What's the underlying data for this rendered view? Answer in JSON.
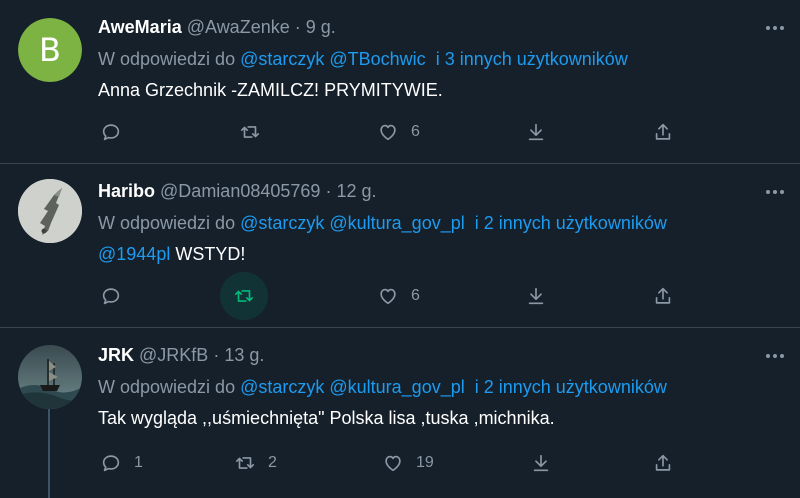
{
  "tweets": [
    {
      "name": "AweMaria",
      "handle": "@AwaZenke",
      "dot": "·",
      "time": "9 g.",
      "avatar_letter": "B",
      "reply_prefix": "W odpowiedzi do ",
      "reply_mention1": "@starczyk",
      "reply_mention2": "@TBochwic",
      "reply_others": "i 3 innych użytkowników",
      "body": "Anna Grzechnik -ZAMILCZ! PRYMITYWIE.",
      "replies": "",
      "retweets": "",
      "likes": "6"
    },
    {
      "name": "Haribo",
      "handle": "@Damian08405769",
      "dot": "·",
      "time": "12 g.",
      "reply_prefix": "W odpowiedzi do ",
      "reply_mention1": "@starczyk",
      "reply_mention2": "@kultura_gov_pl",
      "reply_others": "i 2 innych użytkowników",
      "body_mention": "@1944pl",
      "body": "WSTYD!",
      "replies": "",
      "retweets": "",
      "likes": "6"
    },
    {
      "name": "JRK",
      "handle": "@JRKfB",
      "dot": "·",
      "time": "13 g.",
      "reply_prefix": "W odpowiedzi do ",
      "reply_mention1": "@starczyk",
      "reply_mention2": "@kultura_gov_pl",
      "reply_others": "i 2 innych użytkowników",
      "body": "Tak wygląda ,,uśmiechnięta\" Polska lisa ,tuska ,michnika.",
      "replies": "1",
      "retweets": "2",
      "likes": "19"
    }
  ],
  "icons": [
    "reply-icon",
    "retweet-icon",
    "like-icon",
    "download-icon",
    "share-icon",
    "more-icon"
  ],
  "colors": {
    "background": "#15202b",
    "link": "#1d9bf0",
    "muted": "#8b98a5",
    "retweet_active": "#00ba7c",
    "divider": "#38444d"
  }
}
